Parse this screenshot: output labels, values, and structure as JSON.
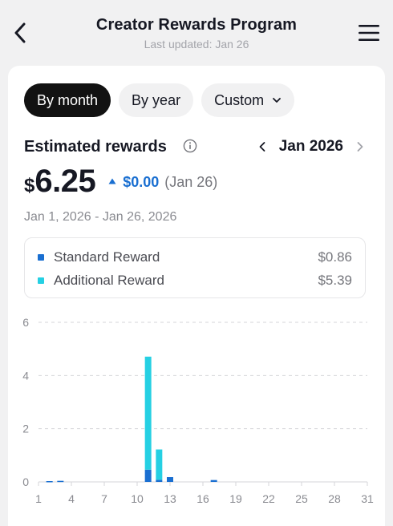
{
  "header": {
    "title": "Creator Rewards Program",
    "subtitle": "Last updated: Jan 26"
  },
  "tabs": [
    {
      "label": "By month",
      "active": true
    },
    {
      "label": "By year",
      "active": false
    },
    {
      "label": "Custom",
      "active": false
    }
  ],
  "summary": {
    "label": "Estimated rewards",
    "month": "Jan 2026",
    "currency": "$",
    "amount": "6.25",
    "change_value": "$0.00",
    "change_date": "(Jan 26)",
    "date_range": "Jan 1, 2026 - Jan 26, 2026"
  },
  "legend": [
    {
      "name": "Standard Reward",
      "value": "$0.86",
      "color": "#1a6fd1"
    },
    {
      "name": "Additional Reward",
      "value": "$5.39",
      "color": "#25d0e3"
    }
  ],
  "colors": {
    "accent": "#1a6fd1",
    "standard": "#1a6fd1",
    "additional": "#25d0e3",
    "gridline": "#d5d6da",
    "tick_text": "#8a8b91"
  },
  "icons": [
    "back-arrow-icon",
    "hamburger-menu-icon",
    "chevron-down-icon",
    "info-icon",
    "chevron-left-icon",
    "chevron-right-icon",
    "triangle-up-icon"
  ],
  "chart_data": {
    "type": "bar",
    "stacked": true,
    "x": [
      1,
      2,
      3,
      4,
      5,
      6,
      7,
      8,
      9,
      10,
      11,
      12,
      13,
      14,
      15,
      16,
      17,
      18,
      19,
      20,
      21,
      22,
      23,
      24,
      25,
      26,
      27,
      28,
      29,
      30,
      31
    ],
    "x_tick_labels": [
      "1",
      "4",
      "7",
      "10",
      "13",
      "16",
      "19",
      "22",
      "25",
      "28",
      "31"
    ],
    "x_tick_values": [
      1,
      4,
      7,
      10,
      13,
      16,
      19,
      22,
      25,
      28,
      31
    ],
    "y_ticks": [
      0,
      2,
      4,
      6
    ],
    "ylim": [
      0,
      6
    ],
    "grid": true,
    "series": [
      {
        "name": "Standard Reward",
        "values": [
          0,
          0.03,
          0.04,
          0,
          0,
          0,
          0,
          0,
          0,
          0,
          0.46,
          0.08,
          0.18,
          0,
          0,
          0,
          0.07,
          0,
          0,
          0,
          0,
          0,
          0,
          0,
          0,
          0,
          0,
          0,
          0,
          0,
          0
        ]
      },
      {
        "name": "Additional Reward",
        "values": [
          0,
          0,
          0,
          0,
          0,
          0,
          0,
          0,
          0,
          0,
          4.25,
          1.14,
          0,
          0,
          0,
          0,
          0,
          0,
          0,
          0,
          0,
          0,
          0,
          0,
          0,
          0,
          0,
          0,
          0,
          0,
          0
        ]
      }
    ]
  }
}
